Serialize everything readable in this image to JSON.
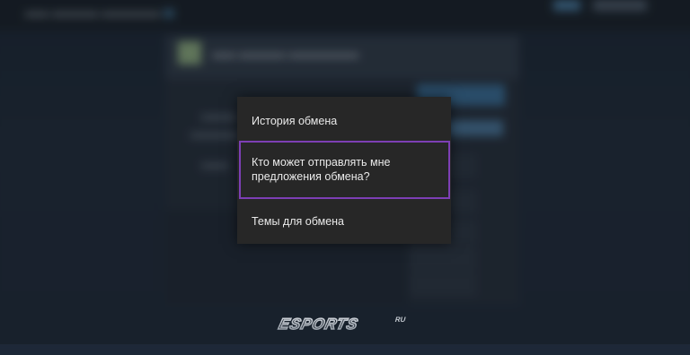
{
  "menu": {
    "items": [
      {
        "label": "История обмена"
      },
      {
        "label": "Кто может отправлять мне предложения обмена?",
        "highlighted": true
      },
      {
        "label": "Темы для обмена"
      }
    ]
  },
  "colors": {
    "menu_background": "#272727",
    "highlight_border": "#7d3fb5",
    "menu_text": "#eaeaea",
    "page_background": "#1b2838"
  },
  "watermark": {
    "text": "ESPORTS",
    "suffix": "RU"
  }
}
